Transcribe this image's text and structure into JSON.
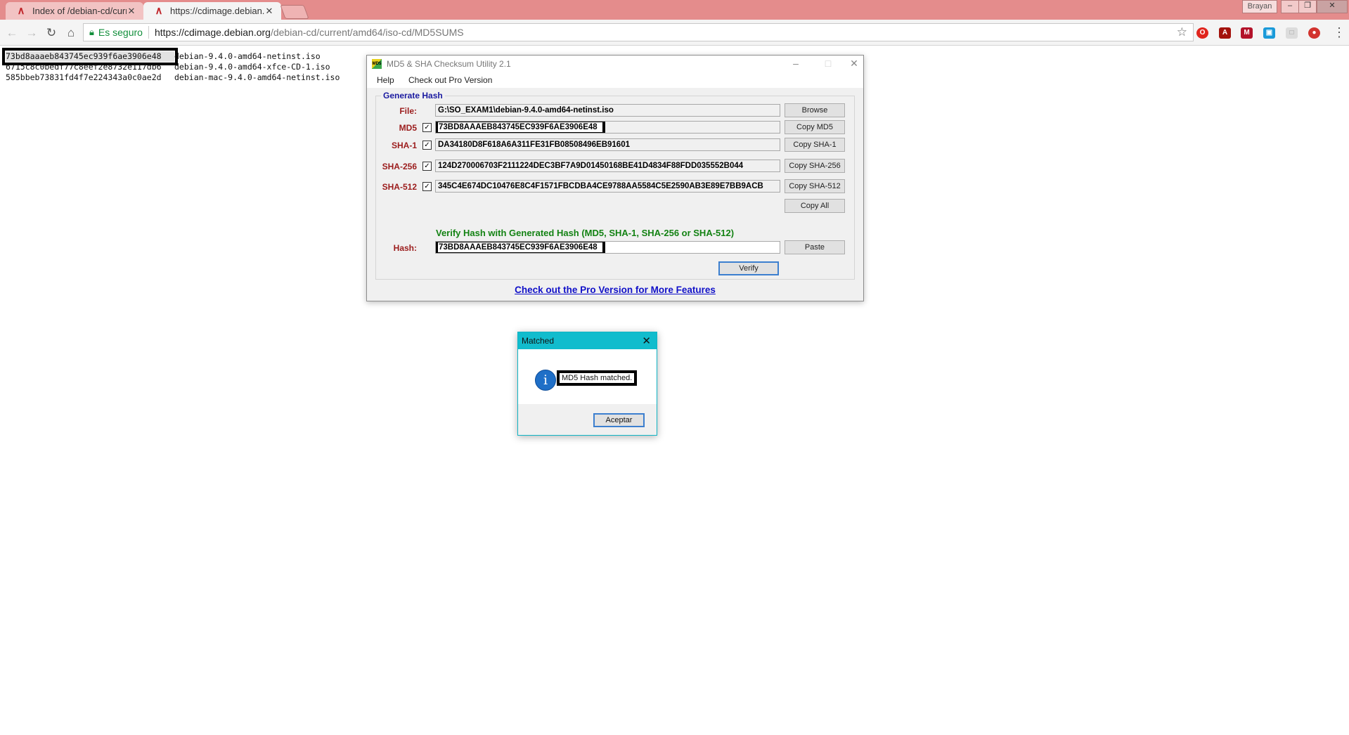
{
  "browser": {
    "tabs": [
      {
        "title": "Index of /debian-cd/curr",
        "active": false
      },
      {
        "title": "https://cdimage.debian.c",
        "active": true
      }
    ],
    "profile": "Brayan",
    "security_label": "Es seguro",
    "url_host": "https://cdimage.debian.org",
    "url_path": "/debian-cd/current/amd64/iso-cd/MD5SUMS"
  },
  "md5sums": [
    {
      "hash": "73bd8aaaeb843745ec939f6ae3906e48",
      "file": "debian-9.4.0-amd64-netinst.iso"
    },
    {
      "hash": "6715c8c0bedf77c8eef2e8732e117db6",
      "file": "debian-9.4.0-amd64-xfce-CD-1.iso"
    },
    {
      "hash": "585bbeb73831fd4f7e224343a0c0ae2d",
      "file": "debian-mac-9.4.0-amd64-netinst.iso"
    }
  ],
  "app": {
    "title": "MD5 & SHA Checksum Utility 2.1",
    "menu": [
      "Help",
      "Check out Pro Version"
    ],
    "group_title": "Generate Hash",
    "file_label": "File:",
    "file_value": "G:\\SO_EXAM1\\debian-9.4.0-amd64-netinst.iso",
    "browse": "Browse",
    "md5_label": "MD5",
    "md5_value": "73BD8AAAEB843745EC939F6AE3906E48",
    "copy_md5": "Copy MD5",
    "sha1_label": "SHA-1",
    "sha1_value": "DA34180D8F618A6A311FE31FB08508496EB91601",
    "copy_sha1": "Copy SHA-1",
    "sha256_label": "SHA-256",
    "sha256_value": "124D270006703F2111224DEC3BF7A9D01450168BE41D4834F88FDD035552B044",
    "copy_sha256": "Copy SHA-256",
    "sha512_label": "SHA-512",
    "sha512_value": "345C4E674DC10476E8C4F1571FBCDBA4CE9788AA5584C5E2590AB3E89E7BB9ACB",
    "copy_sha512": "Copy SHA-512",
    "copy_all": "Copy All",
    "verify_title": "Verify Hash with Generated Hash (MD5, SHA-1, SHA-256 or SHA-512)",
    "hash_label": "Hash:",
    "hash_value": "73BD8AAAEB843745EC939F6AE3906E48",
    "paste": "Paste",
    "verify": "Verify",
    "pro_link": "Check out the Pro Version for More Features"
  },
  "dialog": {
    "title": "Matched",
    "message": "MD5 Hash matched.",
    "ok": "Aceptar"
  }
}
